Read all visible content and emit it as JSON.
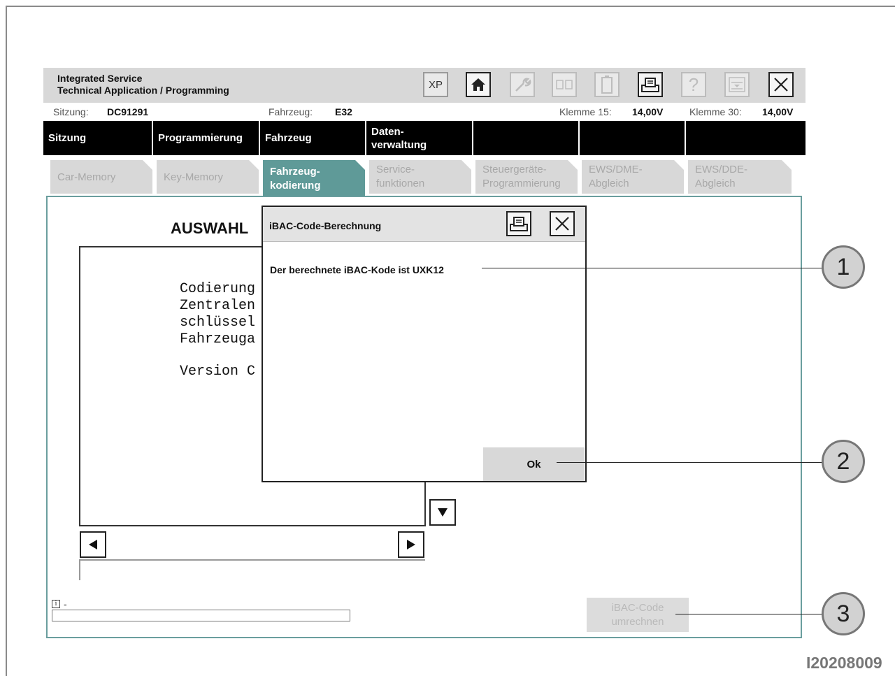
{
  "header": {
    "title_line1": "Integrated Service",
    "title_line2": "Technical Application / Programming",
    "toolbar": {
      "xp_label": "XP",
      "icons": [
        "home-icon",
        "wrench-icon",
        "swap-icon",
        "battery-icon",
        "print-icon",
        "help-icon",
        "minimize-icon",
        "close-icon"
      ]
    }
  },
  "status": {
    "sitzung_label": "Sitzung:",
    "sitzung_value": "DC91291",
    "fahrzeug_label": "Fahrzeug:",
    "fahrzeug_value": "E32",
    "klemme15_label": "Klemme 15:",
    "klemme15_value": "14,00V",
    "klemme30_label": "Klemme 30:",
    "klemme30_value": "14,00V"
  },
  "menu": {
    "items": [
      "Sitzung",
      "Programmierung",
      "Fahrzeug",
      "Daten-",
      "verwaltung"
    ]
  },
  "tabs": {
    "car_memory": "Car-Memory",
    "key_memory": "Key-Memory",
    "kodierung_1": "Fahrzeug-",
    "kodierung_2": "kodierung",
    "service_1": "Service-",
    "service_2": "funktionen",
    "steuer_1": "Steuergeräte-",
    "steuer_2": "Programmierung",
    "ewsdme_1": "EWS/DME-",
    "ewsdme_2": "Abgleich",
    "ewsdde_1": "EWS/DDE-",
    "ewsdde_2": "Abgleich"
  },
  "content": {
    "heading": "AUSWAHL",
    "lines": [
      "Codierung",
      "Zentralen",
      "schlüssel",
      "Fahrzeuga",
      "Version C"
    ],
    "info_text": "-",
    "ibac_button_1": "iBAC-Code",
    "ibac_button_2": "umrechnen"
  },
  "dialog": {
    "title": "iBAC-Code-Berechnung",
    "message": "Der berechnete iBAC-Kode ist UXK12",
    "ok_label": "Ok"
  },
  "callouts": [
    "1",
    "2",
    "3"
  ],
  "image_id": "I20208009"
}
